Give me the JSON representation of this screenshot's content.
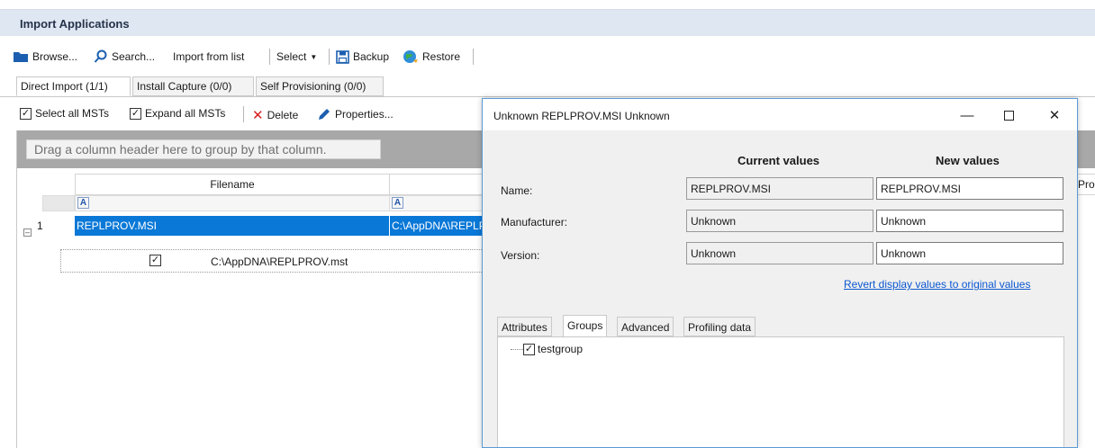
{
  "window": {
    "title": "Import Applications"
  },
  "toolbar": {
    "browse": "Browse...",
    "search": "Search...",
    "import_from_list": "Import from list",
    "select": "Select",
    "backup": "Backup",
    "restore": "Restore"
  },
  "tabs": [
    {
      "label": "Direct Import (1/1)"
    },
    {
      "label": "Install Capture (0/0)"
    },
    {
      "label": "Self Provisioning (0/0)"
    }
  ],
  "subtoolbar": {
    "select_all_msts": "Select all MSTs",
    "expand_all_msts": "Expand all MSTs",
    "delete": "Delete",
    "properties": "Properties..."
  },
  "grid": {
    "group_prompt": "Drag a column header here to group by that column.",
    "columns": [
      "Filename",
      "Pro"
    ],
    "row": {
      "number": "1",
      "filename": "REPLPROV.MSI",
      "path": "C:\\AppDNA\\REPLPROV.MSI"
    },
    "child": {
      "checked": true,
      "mst_path": "C:\\AppDNA\\REPLPROV.mst"
    }
  },
  "dialog": {
    "title": "Unknown REPLPROV.MSI Unknown",
    "current_header": "Current values",
    "new_header": "New values",
    "fields": [
      {
        "label": "Name:",
        "current": "REPLPROV.MSI",
        "new": "REPLPROV.MSI"
      },
      {
        "label": "Manufacturer:",
        "current": "Unknown",
        "new": "Unknown"
      },
      {
        "label": "Version:",
        "current": "Unknown",
        "new": "Unknown"
      }
    ],
    "revert_link": "Revert display values to original values",
    "tabs": [
      {
        "label": "Attributes"
      },
      {
        "label": "Groups"
      },
      {
        "label": "Advanced"
      },
      {
        "label": "Profiling data"
      }
    ],
    "groups": [
      {
        "name": "testgroup",
        "checked": true
      }
    ]
  },
  "colors": {
    "selection": "#0a78d7",
    "title_bar": "#dfe7f2",
    "group_bar": "#a8a8a8",
    "link": "#0b57d0",
    "delete_icon": "#d92020"
  }
}
